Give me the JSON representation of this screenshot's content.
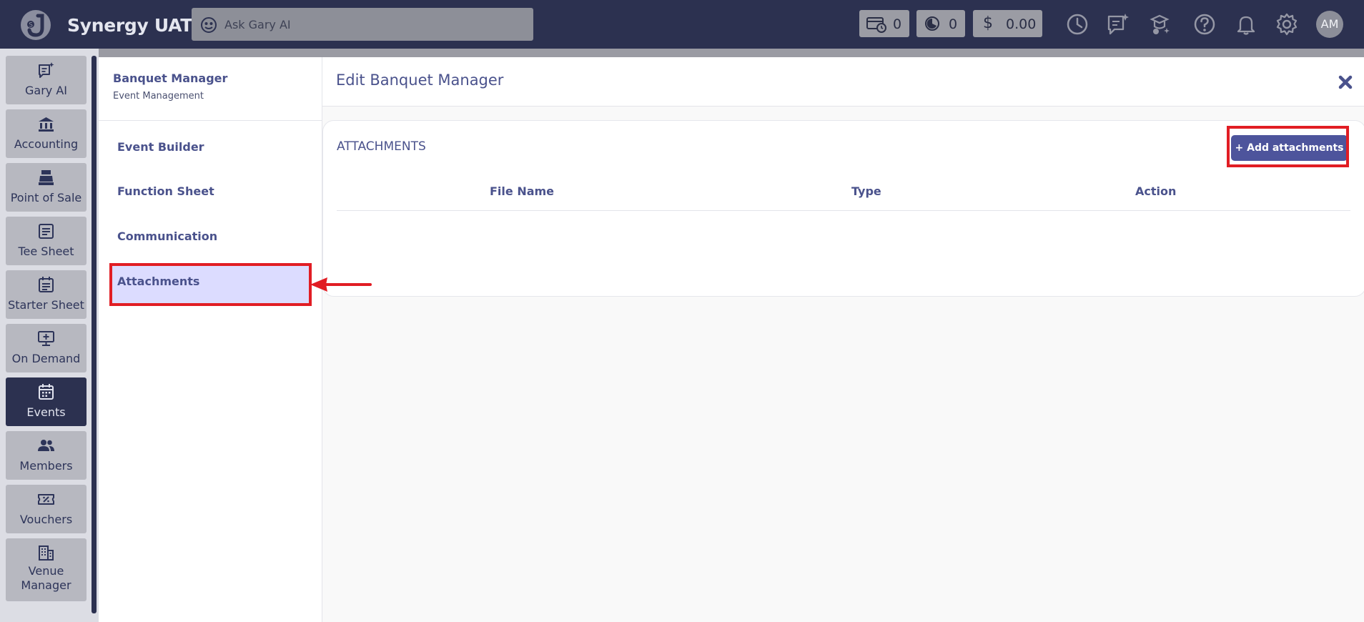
{
  "app": {
    "title": "Synergy UAT"
  },
  "search": {
    "placeholder": "Ask Gary AI"
  },
  "stats": [
    {
      "name": "tickets",
      "value": "0"
    },
    {
      "name": "timer",
      "value": "0"
    },
    {
      "name": "balance",
      "symbol": "$",
      "value": "0.00"
    }
  ],
  "top_icons": [
    "clock-icon",
    "ai-notes-icon",
    "ai-assistant-icon",
    "help-icon",
    "bell-icon",
    "gear-icon"
  ],
  "user": {
    "initials": "AM"
  },
  "sidebar": {
    "items": [
      {
        "label": "Gary AI",
        "icon": "ai-notes-icon"
      },
      {
        "label": "Accounting",
        "icon": "bank-icon"
      },
      {
        "label": "Point of Sale",
        "icon": "cash-register-icon"
      },
      {
        "label": "Tee Sheet",
        "icon": "list-doc-icon"
      },
      {
        "label": "Starter Sheet",
        "icon": "calendar-list-icon"
      },
      {
        "label": "On Demand",
        "icon": "monitor-plus-icon"
      },
      {
        "label": "Events",
        "icon": "calendar-icon",
        "active": true
      },
      {
        "label": "Members",
        "icon": "users-icon"
      },
      {
        "label": "Vouchers",
        "icon": "ticket-icon"
      },
      {
        "label": "Venue Manager",
        "icon": "building-icon"
      }
    ]
  },
  "subnav": {
    "title": "Banquet Manager",
    "subtitle": "Event Management",
    "items": [
      {
        "label": "Event Builder"
      },
      {
        "label": "Function Sheet"
      },
      {
        "label": "Communication"
      },
      {
        "label": "Attachments",
        "active": true
      }
    ]
  },
  "main": {
    "title": "Edit Banquet Manager",
    "section": {
      "title": "ATTACHMENTS",
      "add_button": "+ Add attachments",
      "columns": [
        "File Name",
        "Type",
        "Action"
      ],
      "rows": []
    }
  },
  "colors": {
    "topbar": "#2c3150",
    "accent": "#4a528c",
    "button": "#4d549c",
    "active_tab": "#dcdcff",
    "highlight": "#e11d24"
  }
}
